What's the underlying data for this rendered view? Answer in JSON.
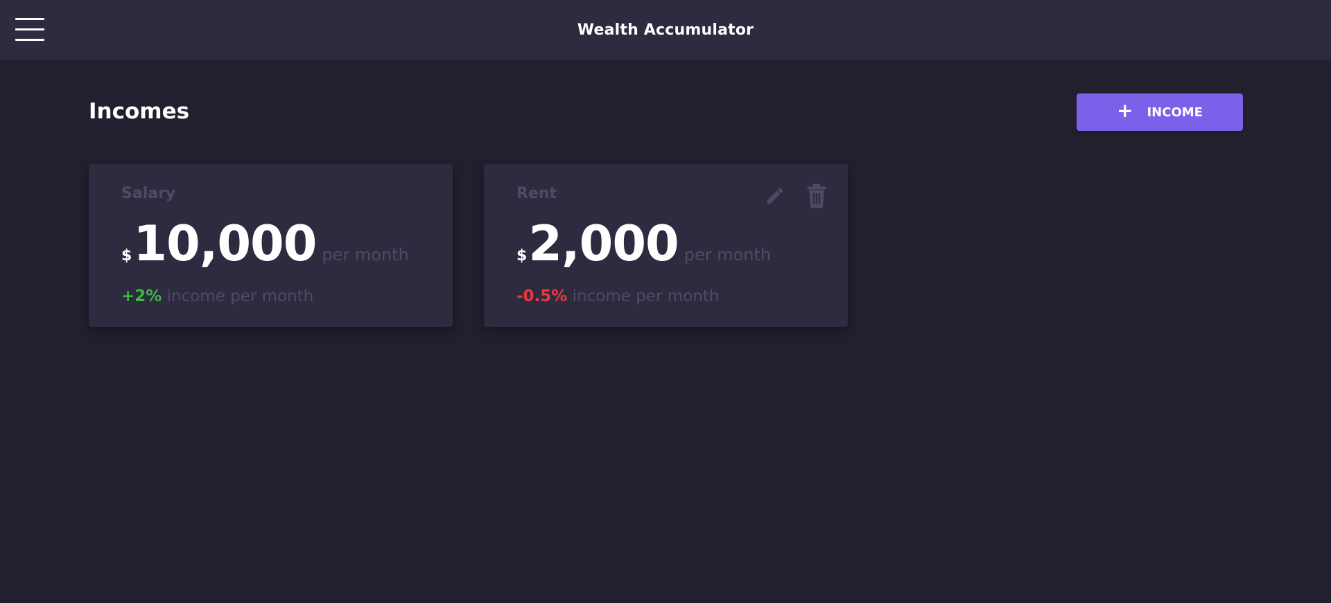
{
  "appbar": {
    "title": "Wealth Accumulator",
    "menu_icon": "hamburger-menu-icon"
  },
  "page": {
    "title": "Incomes",
    "add_button": {
      "icon": "plus-icon",
      "plus_glyph": "+",
      "label": "INCOME"
    }
  },
  "incomes": [
    {
      "name": "Salary",
      "currency": "$",
      "amount": "10,000",
      "period": "per month",
      "growth": "+2%",
      "growth_text": "income per month",
      "growth_color": "#3dbb3d"
    },
    {
      "name": "Rent",
      "currency": "$",
      "amount": "2,000",
      "period": "per month",
      "growth": "-0.5%",
      "growth_text": "income per month",
      "growth_color": "#e8383d",
      "actions": {
        "edit_icon": "pencil-icon",
        "delete_icon": "trash-icon"
      }
    }
  ],
  "colors": {
    "background": "#22202f",
    "surface": "#2e2b40",
    "accent": "#7b61ea",
    "muted_text": "#4f4b63"
  }
}
